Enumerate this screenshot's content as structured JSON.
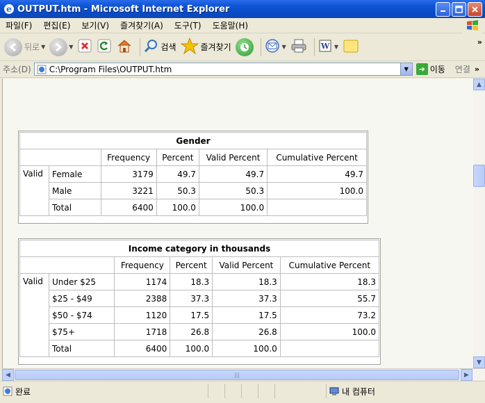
{
  "window": {
    "title": "OUTPUT.htm - Microsoft Internet Explorer"
  },
  "menu": [
    "파일(F)",
    "편집(E)",
    "보기(V)",
    "즐겨찾기(A)",
    "도구(T)",
    "도움말(H)"
  ],
  "toolbar": {
    "back_label": "뒤로",
    "search_label": "검색",
    "favorites_label": "즐겨찾기"
  },
  "address": {
    "label": "주소(D)",
    "url": "C:\\Program Files\\OUTPUT.htm",
    "go_label": "이동",
    "links_label": "연결"
  },
  "status": {
    "left": "완료",
    "zone": "내 컴퓨터"
  },
  "tables": {
    "gender": {
      "title": "Gender",
      "headers": [
        "Frequency",
        "Percent",
        "Valid Percent",
        "Cumulative Percent"
      ],
      "group_label": "Valid",
      "rows": [
        {
          "label": "Female",
          "frequency": "3179",
          "percent": "49.7",
          "valid_percent": "49.7",
          "cumulative": "49.7"
        },
        {
          "label": "Male",
          "frequency": "3221",
          "percent": "50.3",
          "valid_percent": "50.3",
          "cumulative": "100.0"
        },
        {
          "label": "Total",
          "frequency": "6400",
          "percent": "100.0",
          "valid_percent": "100.0",
          "cumulative": ""
        }
      ]
    },
    "income": {
      "title": "Income category in thousands",
      "headers": [
        "Frequency",
        "Percent",
        "Valid Percent",
        "Cumulative Percent"
      ],
      "group_label": "Valid",
      "rows": [
        {
          "label": "Under $25",
          "frequency": "1174",
          "percent": "18.3",
          "valid_percent": "18.3",
          "cumulative": "18.3"
        },
        {
          "label": "$25 - $49",
          "frequency": "2388",
          "percent": "37.3",
          "valid_percent": "37.3",
          "cumulative": "55.7"
        },
        {
          "label": "$50 - $74",
          "frequency": "1120",
          "percent": "17.5",
          "valid_percent": "17.5",
          "cumulative": "73.2"
        },
        {
          "label": "$75+",
          "frequency": "1718",
          "percent": "26.8",
          "valid_percent": "26.8",
          "cumulative": "100.0"
        },
        {
          "label": "Total",
          "frequency": "6400",
          "percent": "100.0",
          "valid_percent": "100.0",
          "cumulative": ""
        }
      ]
    }
  }
}
